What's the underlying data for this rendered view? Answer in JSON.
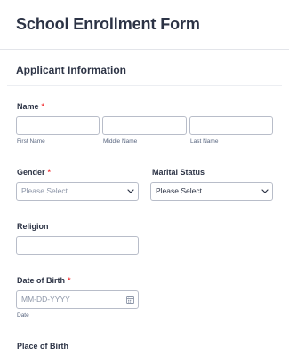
{
  "form": {
    "title": "School Enrollment Form",
    "section_title": "Applicant Information"
  },
  "name_field": {
    "label": "Name",
    "required_mark": "*",
    "sublabels": {
      "first": "First Name",
      "middle": "Middle Name",
      "last": "Last Name"
    }
  },
  "gender_field": {
    "label": "Gender",
    "required_mark": "*",
    "selected": "Please Select"
  },
  "marital_field": {
    "label": "Marital Status",
    "selected": "Please Select"
  },
  "religion_field": {
    "label": "Religion"
  },
  "dob_field": {
    "label": "Date of Birth",
    "required_mark": "*",
    "placeholder": "MM-DD-YYYY",
    "sublabel": "Date"
  },
  "pob_field": {
    "label": "Place of Birth"
  },
  "icons": {
    "select_chevron": "chevron-down-icon",
    "date_picker": "calendar-icon"
  },
  "colors": {
    "text": "#2c3345",
    "required": "#f23a3c",
    "border": "#b8bdc9",
    "placeholder": "#8d96a8"
  }
}
